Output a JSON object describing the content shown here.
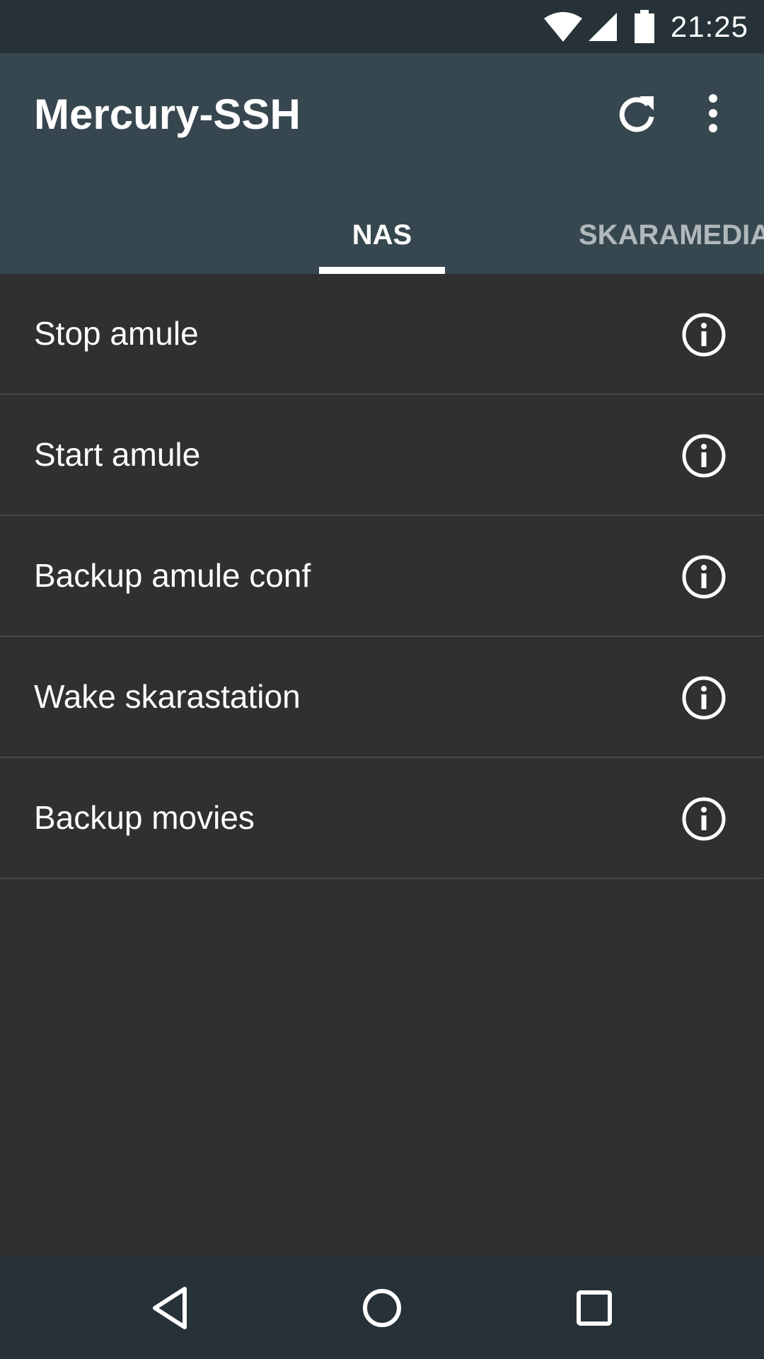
{
  "status_bar": {
    "time": "21:25",
    "icons": [
      "wifi-icon",
      "cell-signal-icon",
      "battery-icon"
    ]
  },
  "app_bar": {
    "title": "Mercury-SSH",
    "actions": [
      "refresh-icon",
      "more-vertical-icon"
    ]
  },
  "tabs": [
    {
      "label": "NAS",
      "selected": true
    },
    {
      "label": "SKARAMEDIA",
      "selected": false
    }
  ],
  "commands": [
    {
      "label": "Stop amule",
      "icon": "info-icon"
    },
    {
      "label": "Start amule",
      "icon": "info-icon"
    },
    {
      "label": "Backup amule conf",
      "icon": "info-icon"
    },
    {
      "label": "Wake skarastation",
      "icon": "info-icon"
    },
    {
      "label": "Backup movies",
      "icon": "info-icon"
    }
  ],
  "nav_bar": {
    "buttons": [
      "back-icon",
      "home-icon",
      "recents-icon"
    ]
  },
  "colors": {
    "status_bar": "#263238",
    "app_bar": "#37474f",
    "background": "#303030",
    "divider": "#474747",
    "tab_inactive": "#b0b8bc"
  }
}
